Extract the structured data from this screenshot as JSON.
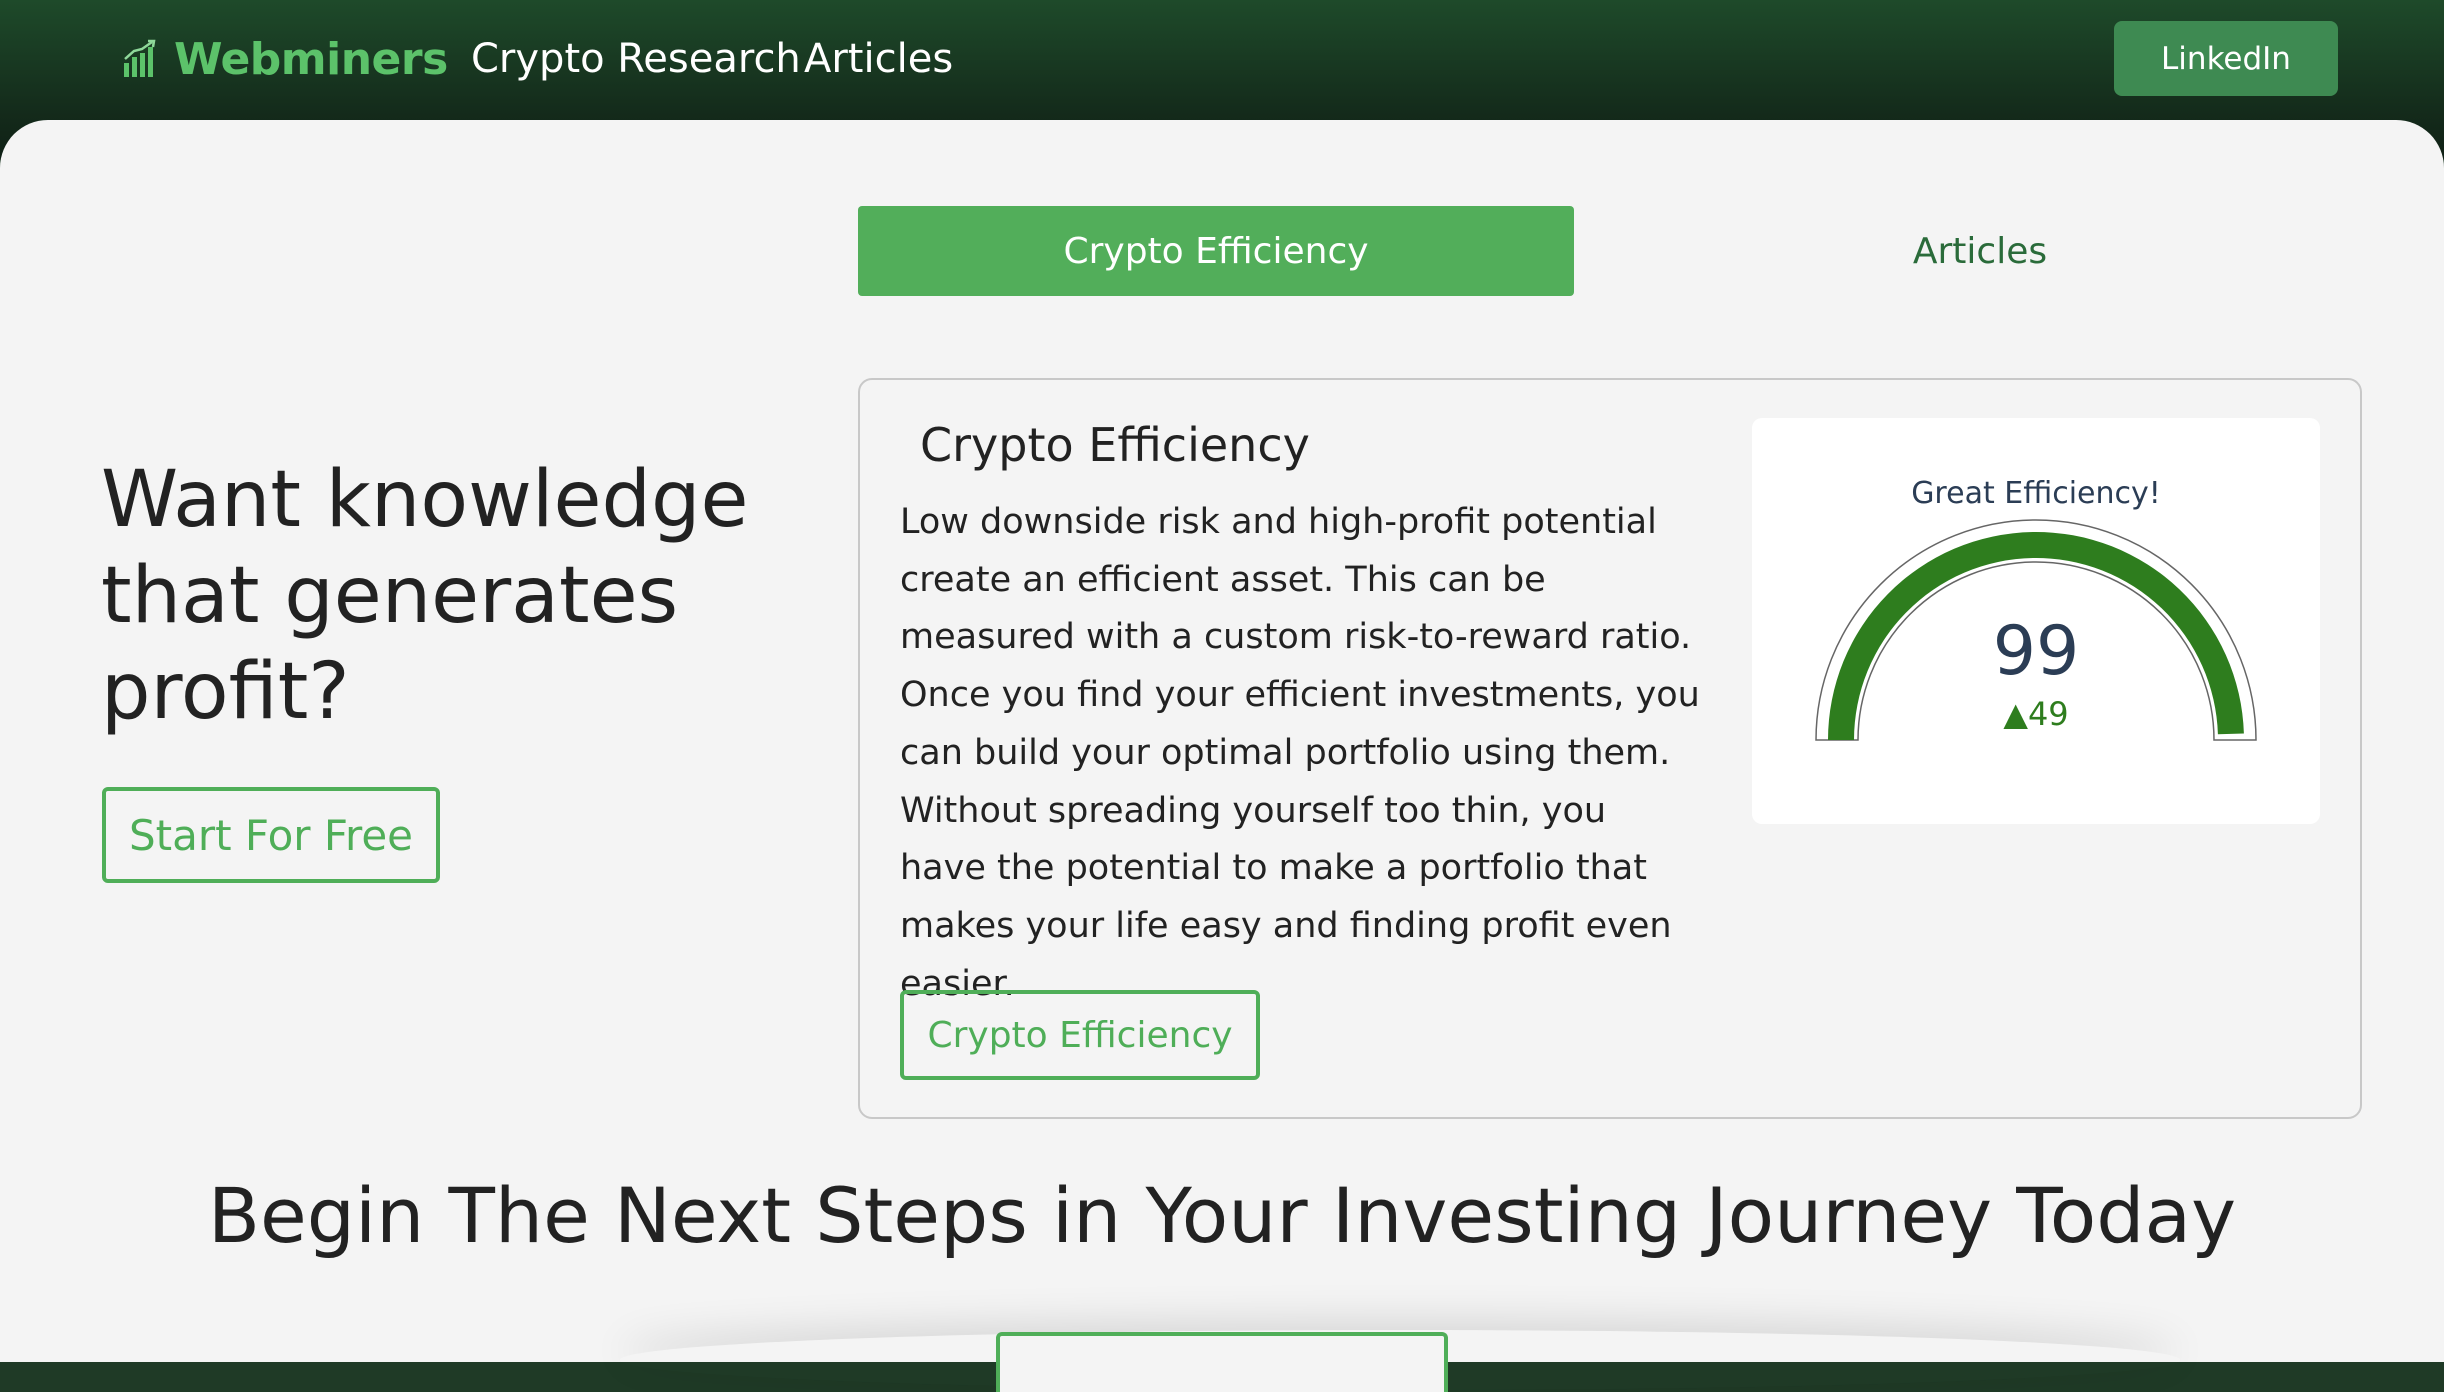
{
  "header": {
    "logo_text": "Webminers",
    "logo_icon": "bar-chart-icon",
    "nav": [
      {
        "label": "Crypto Research"
      },
      {
        "label": "Articles"
      }
    ],
    "linkedin_label": "LinkedIn"
  },
  "tabs": [
    {
      "label": "Crypto Efficiency",
      "active": true
    },
    {
      "label": "Articles",
      "active": false
    }
  ],
  "hero": {
    "title_lines": [
      "Want knowledge",
      "that generates",
      "profit?"
    ],
    "cta_label": "Start For Free"
  },
  "card": {
    "title": "Crypto Efficiency",
    "body": "Low downside risk and high-profit potential create an efficient asset. This can be measured with a custom risk-to-reward ratio. Once you find your efficient investments, you can build your optimal portfolio using them. Without spreading yourself too thin, you have the potential to make a portfolio that makes your life easy and finding profit even easier.",
    "button_label": "Crypto Efficiency",
    "gauge": {
      "label": "Great Efficiency!",
      "value": "99",
      "delta": "▲49",
      "fill_fraction": 0.99,
      "color": "#2e7d1e"
    }
  },
  "section": {
    "title": "Begin The Next Steps in Your Investing Journey Today"
  },
  "colors": {
    "brand_green": "#5cc26a",
    "accent_green": "#52ae5a",
    "dark_header": "#142b1b",
    "background": "#f4f4f4"
  }
}
